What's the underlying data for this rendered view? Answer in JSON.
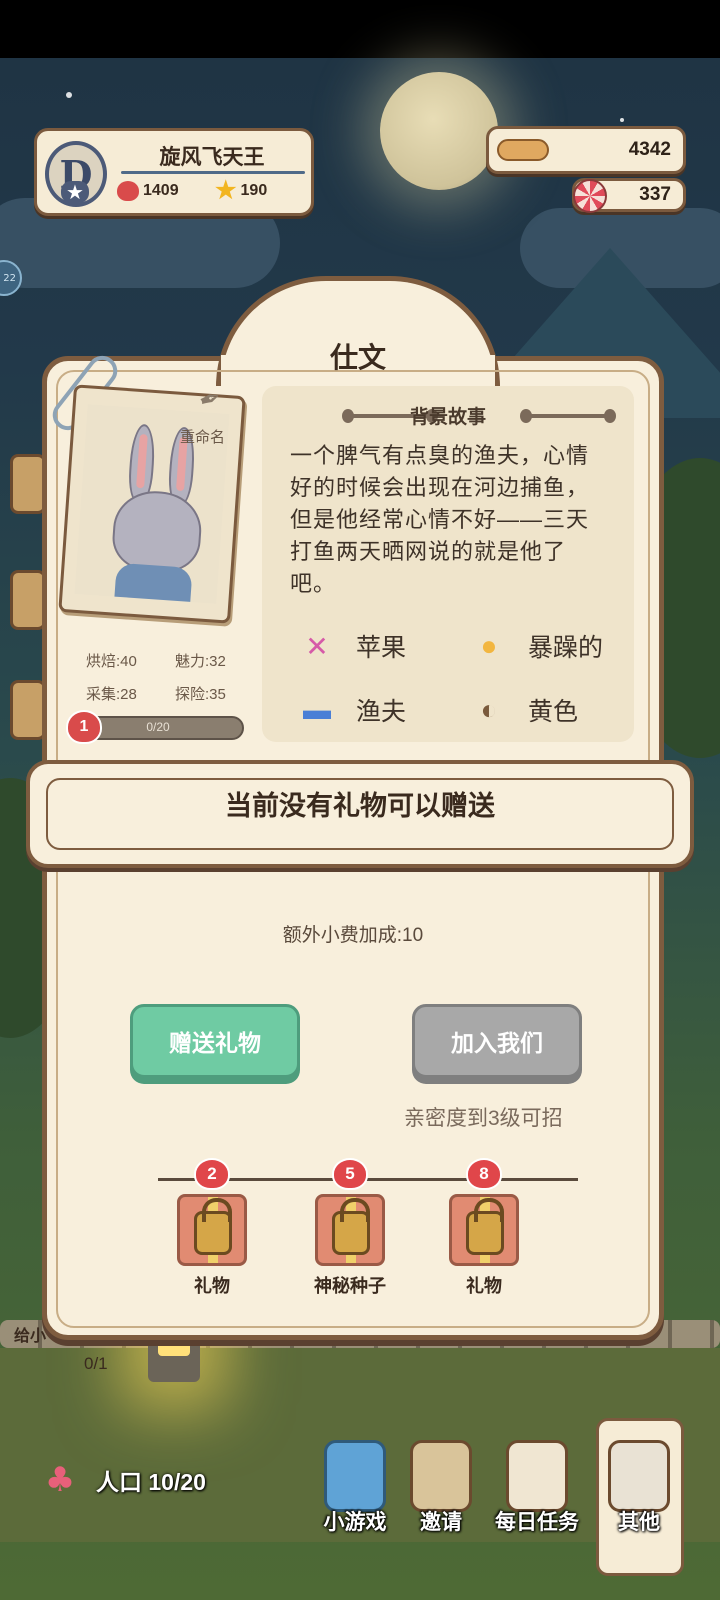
{
  "player": {
    "name": "旋风飞天王",
    "hearts": "1409",
    "stars": "190",
    "rank_letter": "D"
  },
  "currency": {
    "bones": "4342",
    "candy": "337"
  },
  "side_bubble": "22",
  "dialog": {
    "character_name": "仕文",
    "rename_label": "重命名",
    "stats": [
      {
        "label": "烘焙:40"
      },
      {
        "label": "魅力:32"
      },
      {
        "label": "采集:28"
      },
      {
        "label": "探险:35"
      }
    ],
    "level": "1",
    "affinity_progress": "0/20",
    "story_title": "背景故事",
    "story_text": "一个脾气有点臭的渔夫，心情好的时候会出现在河边捕鱼，但是他经常心情不好——三天打鱼两天晒网说的就是他了吧。",
    "traits": {
      "food": "苹果",
      "mood": "暴躁的",
      "job": "渔夫",
      "color": "黄色"
    },
    "banner_message": "当前没有礼物可以赠送",
    "tip_bonus": "额外小费加成:10",
    "gift_button": "赠送礼物",
    "join_button": "加入我们",
    "recruit_note": "亲密度到3级可招",
    "rewards": [
      {
        "level": "2",
        "label": "礼物"
      },
      {
        "level": "5",
        "label": "神秘种子"
      },
      {
        "level": "8",
        "label": "礼物"
      }
    ]
  },
  "quest": {
    "title": "给小",
    "progress": "0/1"
  },
  "population": "人口 10/20",
  "nav": {
    "minigame": "小游戏",
    "invite": "邀请",
    "daily": "每日任务",
    "other": "其他"
  },
  "colors": {
    "gift_button": "#6fcba3",
    "join_button": "#a8a8a8",
    "panel": "#f8efdc",
    "border": "#7e5c3f"
  }
}
